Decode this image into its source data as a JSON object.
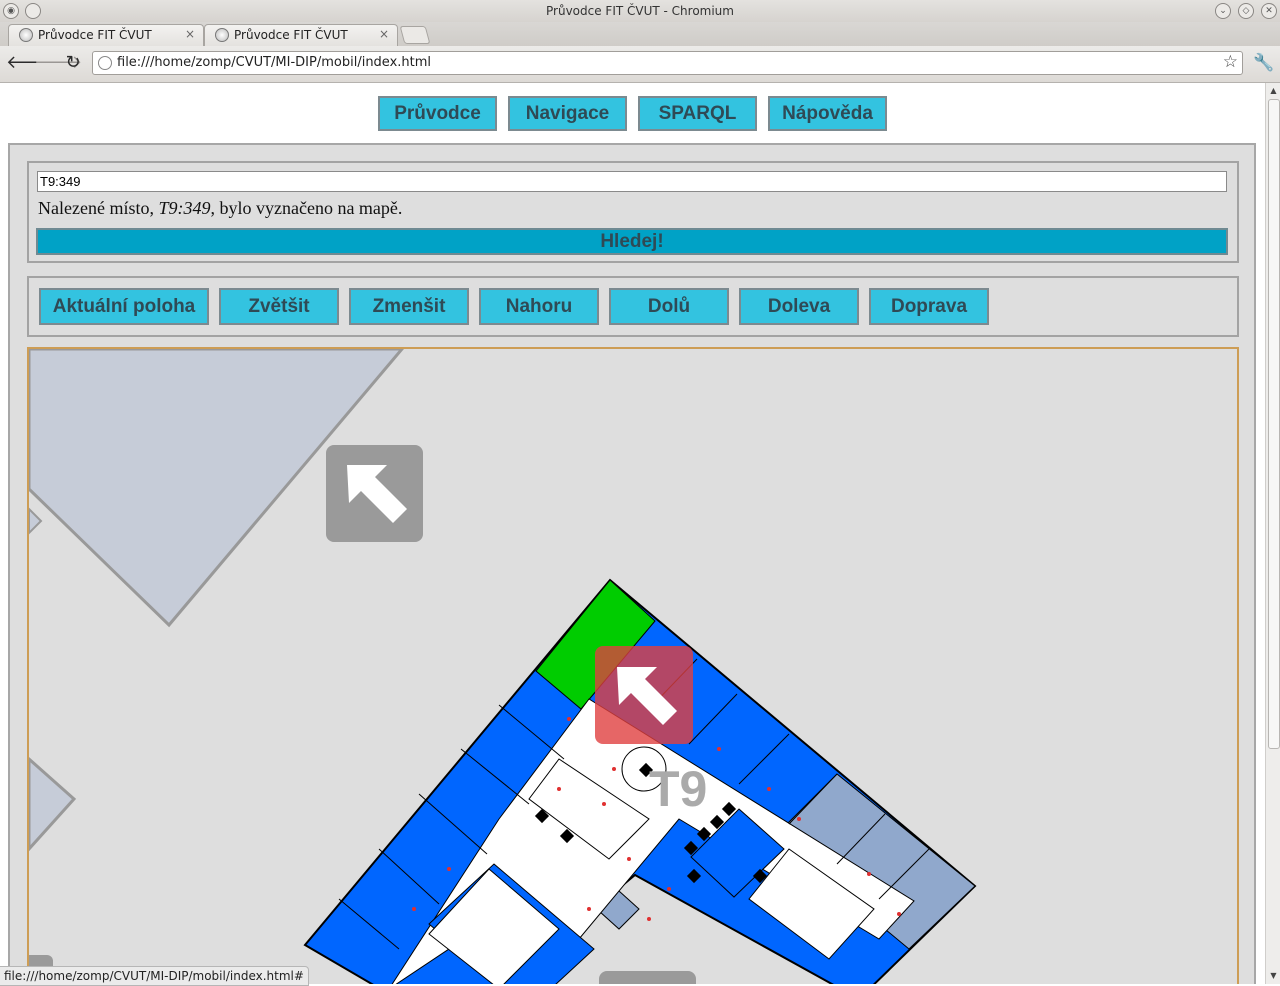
{
  "window": {
    "title": "Průvodce FIT ČVUT - Chromium"
  },
  "tabs": [
    {
      "label": "Průvodce FIT ČVUT",
      "close": "×"
    },
    {
      "label": "Průvodce FIT ČVUT",
      "close": "×"
    }
  ],
  "toolbar": {
    "back": "🡐",
    "forward": "🡒",
    "reload": "↻",
    "url": "file:///home/zomp/CVUT/MI-DIP/mobil/index.html",
    "star": "☆",
    "wrench": "🔧"
  },
  "nav": {
    "guide": "Průvodce",
    "navigation": "Navigace",
    "sparql": "SPARQL",
    "help": "Nápověda"
  },
  "search": {
    "value": "T9:349",
    "result_prefix": "Nalezené místo, ",
    "result_place": "T9:349",
    "result_suffix": ", bylo vyznačeno na mapě.",
    "button": "Hledej!"
  },
  "controls": {
    "location": "Aktuální poloha",
    "zoom_in": "Zvětšit",
    "zoom_out": "Zmenšit",
    "up": "Nahoru",
    "down": "Dolů",
    "left": "Doleva",
    "right": "Doprava"
  },
  "map": {
    "building_label": "T9",
    "colors": {
      "background": "#dedede",
      "rooms": "#0066ff",
      "highlight": "#00cc00",
      "corridor": "#ffffff",
      "secondary_rooms": "#90a8cc",
      "marker": "#e04040"
    }
  },
  "statusbar": {
    "text": "file:///home/zomp/CVUT/MI-DIP/mobil/index.html#"
  }
}
